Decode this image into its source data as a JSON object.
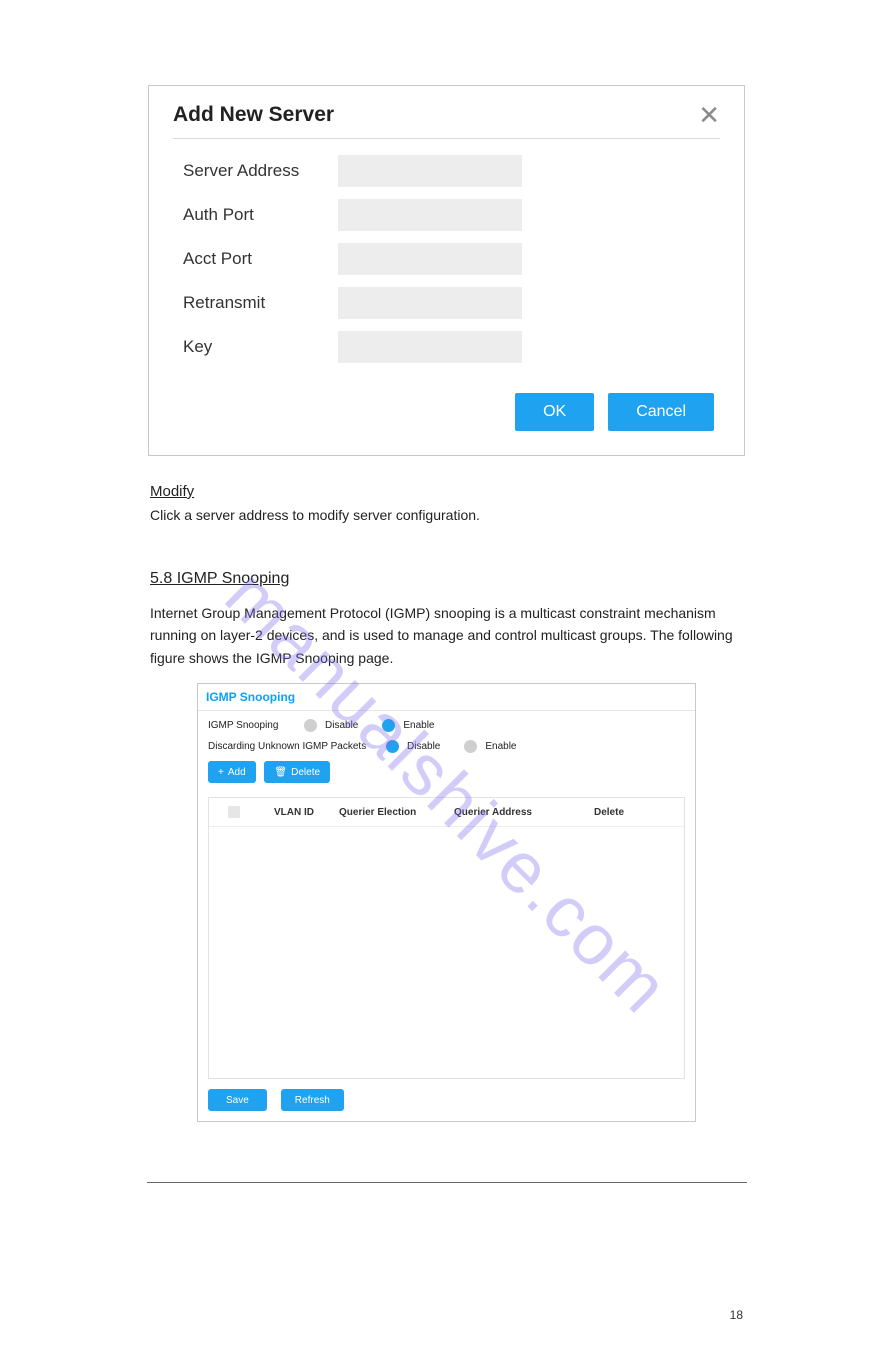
{
  "watermark": "manualshive.com",
  "modal": {
    "title": "Add New Server",
    "fields": {
      "server_address": "Server Address",
      "auth_port": "Auth Port",
      "acct_port": "Acct Port",
      "retransmit": "Retransmit",
      "key": "Key"
    },
    "buttons": {
      "ok": "OK",
      "cancel": "Cancel"
    }
  },
  "modify": {
    "heading": "Modify",
    "text": "Click a server address to modify server configuration."
  },
  "igmp_intro": {
    "heading": "5.8 IGMP Snooping",
    "text": "Internet Group Management Protocol (IGMP) snooping is a multicast constraint mechanism running on layer-2 devices, and is used to manage and control multicast groups. The following figure shows the IGMP Snooping page."
  },
  "igmp_card": {
    "title": "IGMP Snooping",
    "row1_label": "IGMP Snooping",
    "row2_label": "Discarding Unknown IGMP Packets",
    "disable": "Disable",
    "enable": "Enable",
    "add": "Add",
    "delete_btn": "Delete",
    "table": {
      "vlan_id": "VLAN ID",
      "querier_election": "Querier Election",
      "querier_address": "Querier Address",
      "delete": "Delete"
    },
    "bottom": {
      "save": "Save",
      "refresh": "Refresh"
    }
  },
  "page_number": "18"
}
